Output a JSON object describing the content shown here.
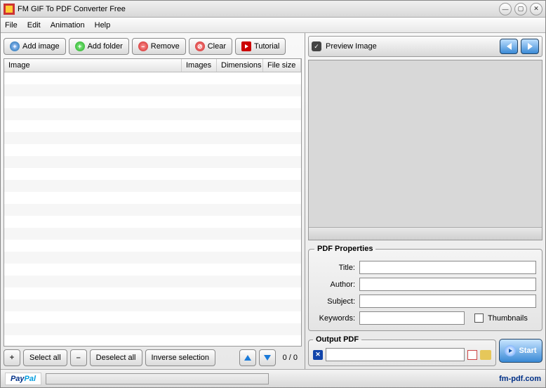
{
  "title": "FM GIF To PDF Converter Free",
  "menu": {
    "file": "File",
    "edit": "Edit",
    "animation": "Animation",
    "help": "Help"
  },
  "toolbar": {
    "add_image": "Add image",
    "add_folder": "Add folder",
    "remove": "Remove",
    "clear": "Clear",
    "tutorial": "Tutorial"
  },
  "table": {
    "headers": {
      "image": "Image",
      "images": "Images",
      "dimensions": "Dimensions",
      "filesize": "File size"
    }
  },
  "bottom": {
    "select_all": "Select all",
    "deselect_all": "Deselect all",
    "inverse": "Inverse selection",
    "counter": "0 / 0"
  },
  "preview": {
    "label": "Preview Image"
  },
  "pdf": {
    "legend": "PDF Properties",
    "title_label": "Title:",
    "author_label": "Author:",
    "subject_label": "Subject:",
    "keywords_label": "Keywords:",
    "thumbnails": "Thumbnails",
    "title": "",
    "author": "",
    "subject": "",
    "keywords": ""
  },
  "output": {
    "legend": "Output PDF",
    "path": "",
    "start": "Start"
  },
  "status": {
    "paypal_a": "Pay",
    "paypal_b": "Pal",
    "link": "fm-pdf.com"
  }
}
